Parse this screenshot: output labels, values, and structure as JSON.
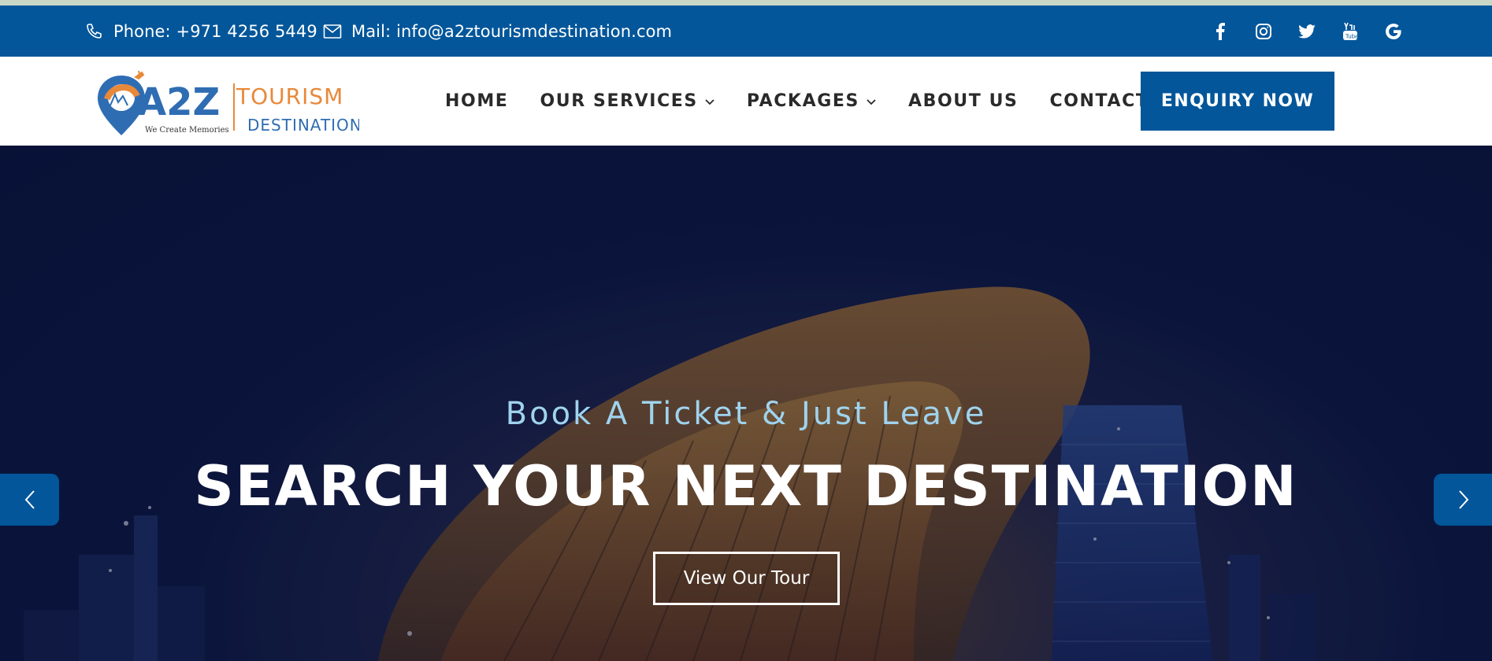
{
  "topbar": {
    "phone": "Phone: +971 4256 5449",
    "mail": "Mail: info@a2ztourismdestination.com",
    "socials": [
      "facebook-icon",
      "instagram-icon",
      "twitter-icon",
      "youtube-icon",
      "google-icon"
    ]
  },
  "logo": {
    "mark": "A2Z",
    "word1": "TOURISM",
    "word2": "DESTINATION",
    "tagline": "We Create Memories"
  },
  "nav": {
    "items": [
      {
        "label": "HOME",
        "dropdown": false
      },
      {
        "label": "OUR SERVICES",
        "dropdown": true
      },
      {
        "label": "PACKAGES",
        "dropdown": true
      },
      {
        "label": "ABOUT US",
        "dropdown": false
      },
      {
        "label": "CONTACT US",
        "dropdown": false
      }
    ],
    "cta": "ENQUIRY NOW"
  },
  "hero": {
    "subtitle": "Book A Ticket & Just Leave",
    "title": "SEARCH YOUR NEXT DESTINATION",
    "button": "View Our Tour"
  },
  "colors": {
    "brand_blue": "#03569a",
    "brand_orange": "#e8893a",
    "hero_subtitle": "#9fd3ee"
  }
}
